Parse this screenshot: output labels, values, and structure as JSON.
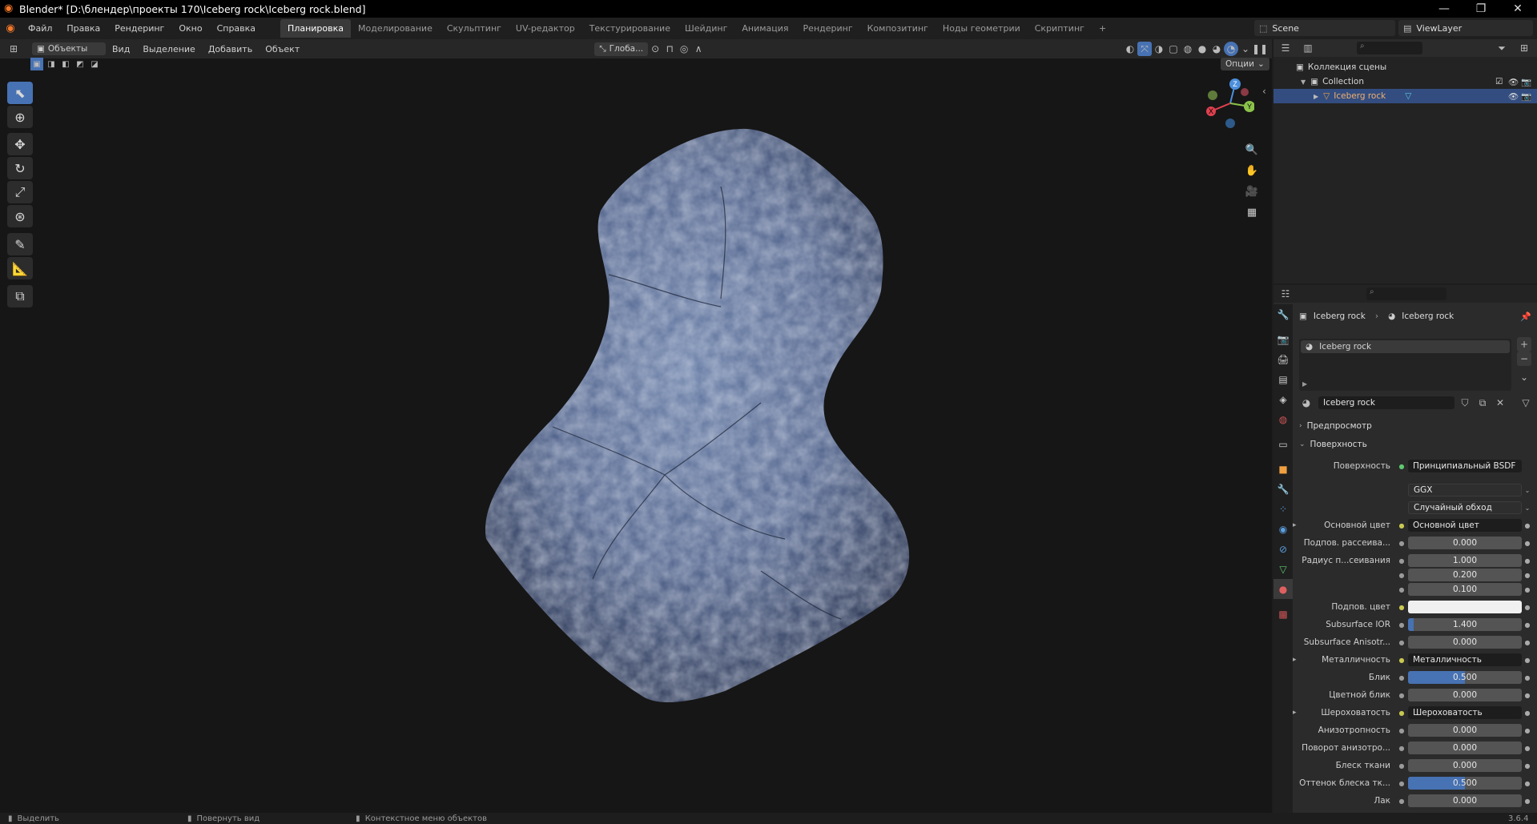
{
  "window": {
    "title": "Blender* [D:\\блендер\\проекты 170\\Iceberg rock\\Iceberg rock.blend]",
    "controls": [
      "—",
      "❐",
      "✕"
    ]
  },
  "menubar": {
    "menus": [
      "Файл",
      "Правка",
      "Рендеринг",
      "Окно",
      "Справка"
    ],
    "workspaces": [
      "Планировка",
      "Моделирование",
      "Скульптинг",
      "UV-редактор",
      "Текстурирование",
      "Шейдинг",
      "Анимация",
      "Рендеринг",
      "Композитинг",
      "Ноды геометрии",
      "Скриптинг"
    ],
    "active_workspace": 0,
    "add_tab": "+",
    "scene": "Scene",
    "view_layer": "ViewLayer"
  },
  "header3d": {
    "mode": "Объекты",
    "menus": [
      "Вид",
      "Выделение",
      "Добавить",
      "Объект"
    ],
    "orientation": "Глоба...",
    "options": "Опции"
  },
  "outliner": {
    "scene_collection": "Коллекция сцены",
    "collection": "Collection",
    "object": "Iceberg rock"
  },
  "properties": {
    "breadcrumb_object": "Iceberg rock",
    "breadcrumb_material": "Iceberg rock",
    "slot_material": "Iceberg rock",
    "material_name": "Iceberg rock",
    "panels": {
      "preview": "Предпросмотр",
      "surface": "Поверхность"
    },
    "surface_label": "Поверхность",
    "surface_value": "Принципиальный BSDF",
    "distribution": "GGX",
    "subsurface_method": "Случайный обход",
    "rows": [
      {
        "label": "Основной цвет",
        "value": "Основной цвет",
        "type": "link",
        "expand": true
      },
      {
        "label": "Подпов. рассеива...",
        "value": "0.000",
        "type": "num",
        "fill": 0
      },
      {
        "label": "Радиус п...сеивания",
        "value": "1.000",
        "type": "num",
        "fill": 0
      },
      {
        "label": "",
        "value": "0.200",
        "type": "num",
        "fill": 0
      },
      {
        "label": "",
        "value": "0.100",
        "type": "num",
        "fill": 0
      },
      {
        "label": "Подпов. цвет",
        "value": "",
        "type": "color",
        "color": "#f0f0f0"
      },
      {
        "label": "Subsurface IOR",
        "value": "1.400",
        "type": "num",
        "fill": 0.05
      },
      {
        "label": "Subsurface Anisotr...",
        "value": "0.000",
        "type": "num",
        "fill": 0
      },
      {
        "label": "Металличность",
        "value": "Металличность",
        "type": "link",
        "expand": true
      },
      {
        "label": "Блик",
        "value": "0.500",
        "type": "num",
        "fill": 0.5
      },
      {
        "label": "Цветной блик",
        "value": "0.000",
        "type": "num",
        "fill": 0
      },
      {
        "label": "Шероховатость",
        "value": "Шероховатость",
        "type": "link",
        "expand": true
      },
      {
        "label": "Анизотропность",
        "value": "0.000",
        "type": "num",
        "fill": 0
      },
      {
        "label": "Поворот анизотро...",
        "value": "0.000",
        "type": "num",
        "fill": 0
      },
      {
        "label": "Блеск ткани",
        "value": "0.000",
        "type": "num",
        "fill": 0
      },
      {
        "label": "Оттенок блеска тк...",
        "value": "0.500",
        "type": "num",
        "fill": 0.5
      },
      {
        "label": "Лак",
        "value": "0.000",
        "type": "num",
        "fill": 0
      }
    ]
  },
  "gizmo": {
    "x": "X",
    "y": "Y",
    "z": "Z"
  },
  "statusbar": {
    "select": "Выделить",
    "rotate": "Повернуть вид",
    "context": "Контекстное меню объектов",
    "version": "3.6.4"
  },
  "colors": {
    "accent": "#4772b3",
    "selected_row": "#334d80",
    "x_axis": "#e0404f",
    "y_axis": "#8bc34a",
    "z_axis": "#4c8fdd"
  }
}
